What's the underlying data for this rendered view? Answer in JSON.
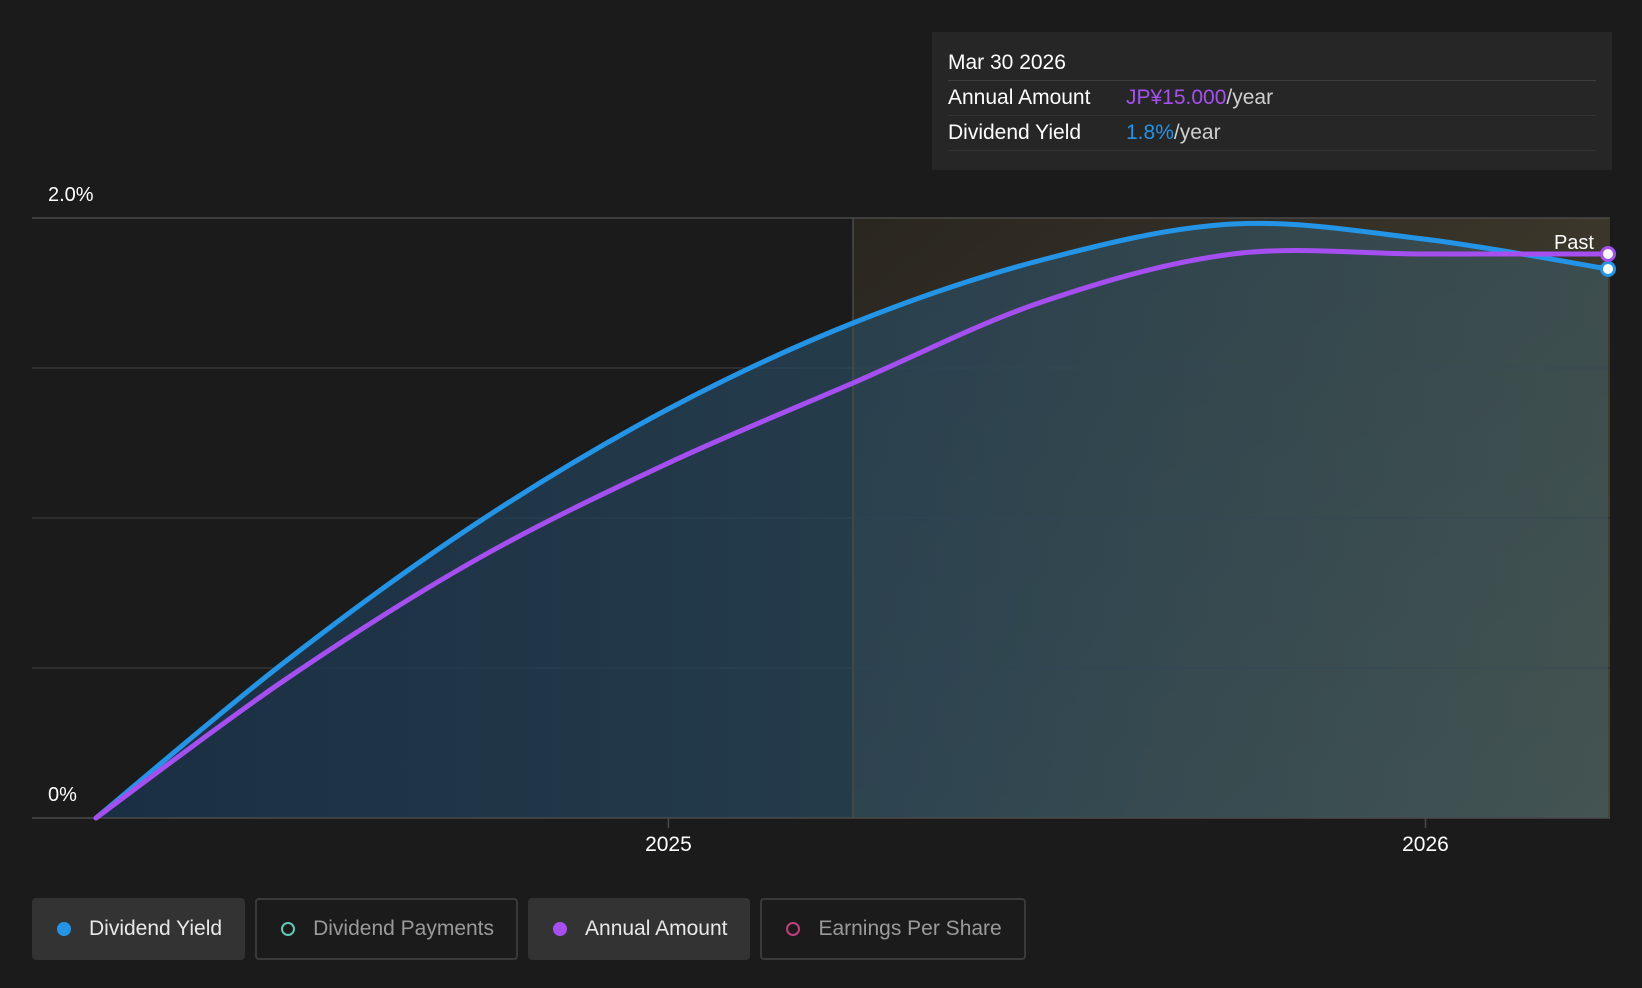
{
  "tooltip": {
    "date": "Mar 30 2026",
    "rows": [
      {
        "key": "Annual Amount",
        "value": "JP¥15.000",
        "unit": "/year"
      },
      {
        "key": "Dividend Yield",
        "value": "1.8%",
        "unit": "/year"
      }
    ]
  },
  "legend": {
    "items": [
      {
        "label": "Dividend Yield",
        "active": true,
        "color": "#2394e6"
      },
      {
        "label": "Dividend Payments",
        "active": false,
        "color": "#5fc9b6"
      },
      {
        "label": "Annual Amount",
        "active": true,
        "color": "#a64ff0"
      },
      {
        "label": "Earnings Per Share",
        "active": false,
        "color": "#c23f7c"
      }
    ]
  },
  "chart_data": {
    "type": "line",
    "x_ticks": [
      "2025",
      "2026"
    ],
    "y_ticks": [
      "0%",
      "2.0%"
    ],
    "ylim": [
      0,
      2.0
    ],
    "xlim": [
      "2024-03-31",
      "2026-03-30"
    ],
    "past_label": "Past",
    "past_region_start": "2025-03-31",
    "grid": true,
    "series": [
      {
        "name": "Dividend Yield",
        "color": "#2394e6",
        "x": [
          "2024-03-31",
          "2024-06-30",
          "2024-09-30",
          "2024-12-31",
          "2025-03-31",
          "2025-06-30",
          "2025-09-30",
          "2025-12-31",
          "2026-03-30"
        ],
        "y": [
          0.0,
          0.52,
          0.98,
          1.36,
          1.65,
          1.86,
          1.98,
          1.93,
          1.83
        ]
      },
      {
        "name": "Annual Amount",
        "color": "#a64ff0",
        "x": [
          "2024-03-31",
          "2024-06-30",
          "2024-09-30",
          "2024-12-31",
          "2025-03-31",
          "2025-06-30",
          "2025-09-30",
          "2025-12-31",
          "2026-03-30"
        ],
        "y": [
          0.0,
          0.46,
          0.86,
          1.18,
          1.45,
          1.72,
          1.88,
          1.88,
          1.88
        ]
      }
    ]
  }
}
